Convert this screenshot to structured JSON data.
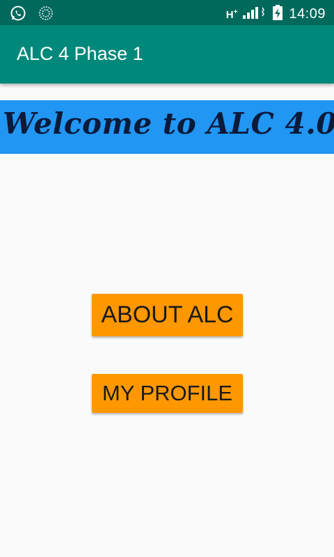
{
  "status_bar": {
    "network_type": "H",
    "network_sup": "+",
    "time": "14:09",
    "icons": [
      "whatsapp-icon",
      "sync-icon",
      "signal-icon",
      "battery-charging-icon"
    ]
  },
  "app_bar": {
    "title": "ALC 4 Phase 1",
    "color": "#00897b"
  },
  "banner": {
    "text": "Welcome to ALC 4.0",
    "color": "#2196f3"
  },
  "buttons": {
    "about_label": "ABOUT ALC",
    "profile_label": "MY PROFILE",
    "color": "#ff9800"
  }
}
